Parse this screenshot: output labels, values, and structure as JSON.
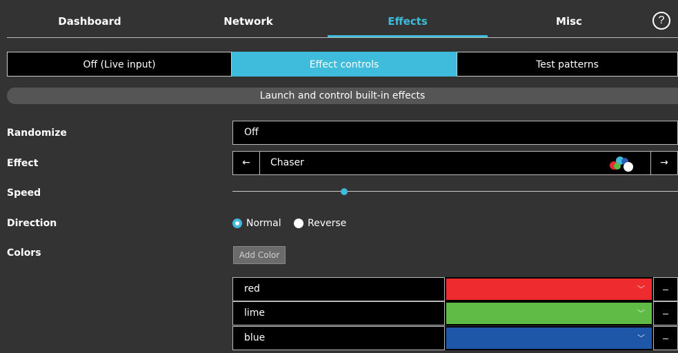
{
  "nav": {
    "tabs": [
      {
        "label": "Dashboard"
      },
      {
        "label": "Network"
      },
      {
        "label": "Effects"
      },
      {
        "label": "Misc"
      }
    ],
    "active": "Effects",
    "help_label": "?"
  },
  "modes": {
    "items": [
      {
        "label": "Off (Live input)"
      },
      {
        "label": "Effect controls"
      },
      {
        "label": "Test patterns"
      }
    ],
    "active": "Effect controls"
  },
  "banner": "Launch and control built-in effects",
  "form": {
    "randomize": {
      "label": "Randomize",
      "value": "Off"
    },
    "effect": {
      "label": "Effect",
      "value": "Chaser",
      "prev": "←",
      "next": "→"
    },
    "speed": {
      "label": "Speed",
      "fraction": 0.25
    },
    "direction": {
      "label": "Direction",
      "options": [
        "Normal",
        "Reverse"
      ],
      "selected": "Normal"
    },
    "colors": {
      "label": "Colors",
      "add_label": "Add Color",
      "remove_label": "–",
      "chevron": "﹀",
      "items": [
        {
          "name": "red",
          "hex": "#ee2b2f"
        },
        {
          "name": "lime",
          "hex": "#5fba46"
        },
        {
          "name": "blue",
          "hex": "#1e56a8"
        }
      ]
    }
  },
  "theme": {
    "accent": "#3fbcdb",
    "background": "#333333"
  }
}
